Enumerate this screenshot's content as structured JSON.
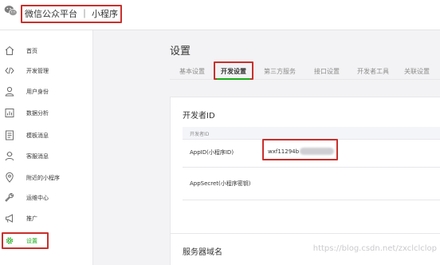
{
  "header": {
    "brand": "微信公众平台 ｜ 小程序"
  },
  "sidebar": {
    "items": [
      {
        "label": "首页",
        "icon": "home-icon"
      },
      {
        "label": "开发管理",
        "icon": "code-icon"
      },
      {
        "label": "用户身份",
        "icon": "user-icon"
      },
      {
        "label": "数据分析",
        "icon": "chart-icon"
      },
      {
        "label": "模板消息",
        "icon": "document-icon"
      },
      {
        "label": "客服消息",
        "icon": "support-icon"
      },
      {
        "label": "附近的小程序",
        "icon": "location-pin-icon"
      },
      {
        "label": "运维中心",
        "icon": "wrench-icon"
      },
      {
        "label": "推广",
        "icon": "megaphone-icon"
      },
      {
        "label": "设置",
        "icon": "gear-icon",
        "active": true
      }
    ]
  },
  "main": {
    "title": "设置",
    "tabs": [
      {
        "label": "基本设置"
      },
      {
        "label": "开发设置",
        "active": true
      },
      {
        "label": "第三方服务"
      },
      {
        "label": "接口设置"
      },
      {
        "label": "开发者工具"
      },
      {
        "label": "关联设置"
      }
    ],
    "developer_card": {
      "title": "开发者ID",
      "table_header": "开发者ID",
      "rows": [
        {
          "label": "AppID(小程序ID)",
          "value": "wxf11294b"
        },
        {
          "label": "AppSecret(小程序密钥)"
        }
      ]
    },
    "server_card": {
      "title": "服务器域名"
    }
  },
  "watermark": "https://blog.csdn.net/zxclclclop",
  "colors": {
    "accent": "#1aad19",
    "highlight": "#c9302c"
  }
}
